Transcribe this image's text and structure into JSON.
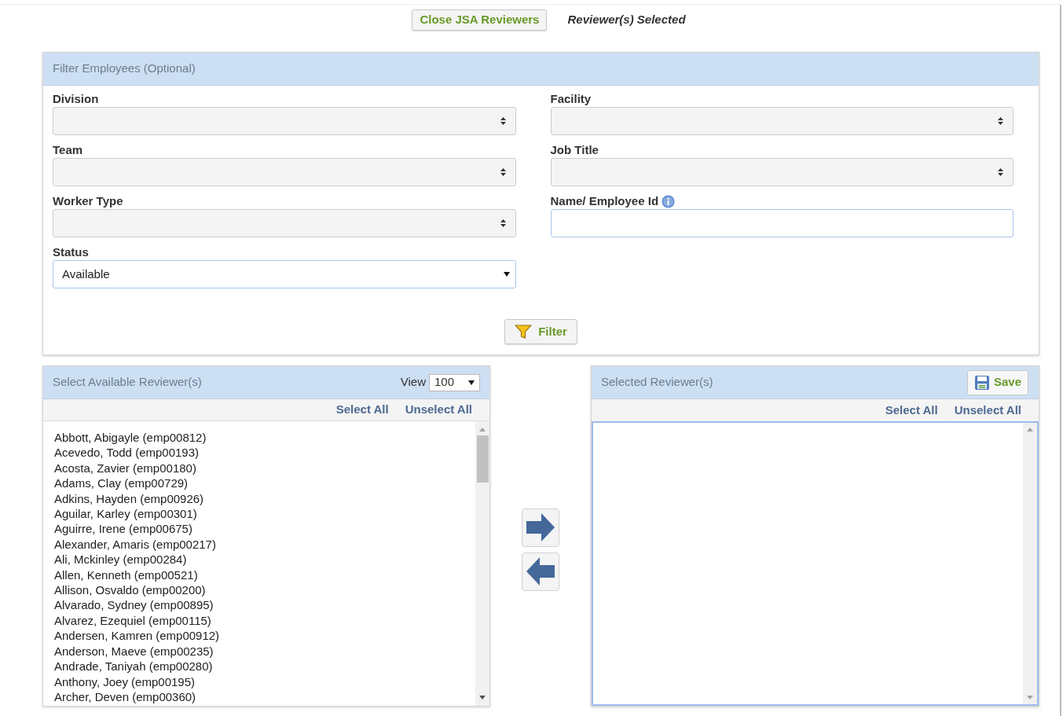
{
  "top_bar": {
    "close_button": "Close JSA Reviewers",
    "status_text": "Reviewer(s) Selected"
  },
  "filter_panel": {
    "title": "Filter Employees (Optional)",
    "fields": [
      {
        "kind": "select",
        "label": "Division"
      },
      {
        "kind": "select",
        "label": "Facility"
      },
      {
        "kind": "select",
        "label": "Team"
      },
      {
        "kind": "select",
        "label": "Job Title"
      },
      {
        "kind": "select",
        "label": "Worker Type"
      },
      {
        "kind": "text",
        "label": "Name/ Employee Id",
        "info": true
      },
      {
        "kind": "dropdown",
        "label": "Status",
        "value": "Available"
      }
    ],
    "filter_button": "Filter"
  },
  "available_panel": {
    "title": "Select Available Reviewer(s)",
    "view_label": "View",
    "view_value": "100",
    "select_all": "Select All",
    "unselect_all": "Unselect All",
    "items": [
      "Abbott, Abigayle (emp00812)",
      "Acevedo, Todd (emp00193)",
      "Acosta, Zavier (emp00180)",
      "Adams, Clay (emp00729)",
      "Adkins, Hayden (emp00926)",
      "Aguilar, Karley (emp00301)",
      "Aguirre, Irene (emp00675)",
      "Alexander, Amaris (emp00217)",
      "Ali, Mckinley (emp00284)",
      "Allen, Kenneth (emp00521)",
      "Allison, Osvaldo (emp00200)",
      "Alvarado, Sydney (emp00895)",
      "Alvarez, Ezequiel (emp00115)",
      "Andersen, Kamren (emp00912)",
      "Anderson, Maeve (emp00235)",
      "Andrade, Taniyah (emp00280)",
      "Anthony, Joey (emp00195)",
      "Archer, Deven (emp00360)"
    ]
  },
  "selected_panel": {
    "title": "Selected Reviewer(s)",
    "save_button": "Save",
    "select_all": "Select All",
    "unselect_all": "Unselect All"
  }
}
